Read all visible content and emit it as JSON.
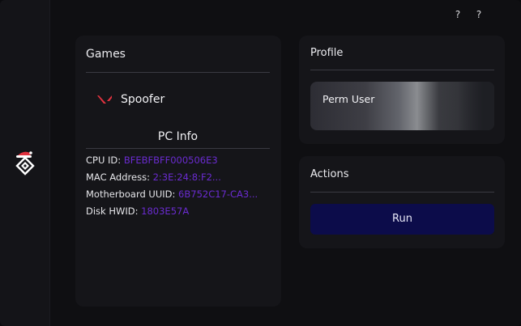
{
  "titlebar": {
    "help_1": "?",
    "help_2": "?"
  },
  "games": {
    "title": "Games",
    "items": [
      {
        "label": "Spoofer",
        "icon": "valorant-v-icon"
      }
    ]
  },
  "pc_info": {
    "title": "PC Info",
    "rows": [
      {
        "label": "CPU ID:",
        "value": "BFEBFBFF000506E3"
      },
      {
        "label": "MAC Address:",
        "value": "2:3E:24:8:F2..."
      },
      {
        "label": "Motherboard UUID:",
        "value": "6B752C17-CA3..."
      },
      {
        "label": "Disk HWID:",
        "value": "1803E57A"
      }
    ]
  },
  "profile": {
    "title": "Profile",
    "user_label": "Perm User"
  },
  "actions": {
    "title": "Actions",
    "run_label": "Run"
  },
  "colors": {
    "accent": "#6a2bd0",
    "run_button": "#0c0c4a",
    "valorant_red": "#e2323f"
  }
}
